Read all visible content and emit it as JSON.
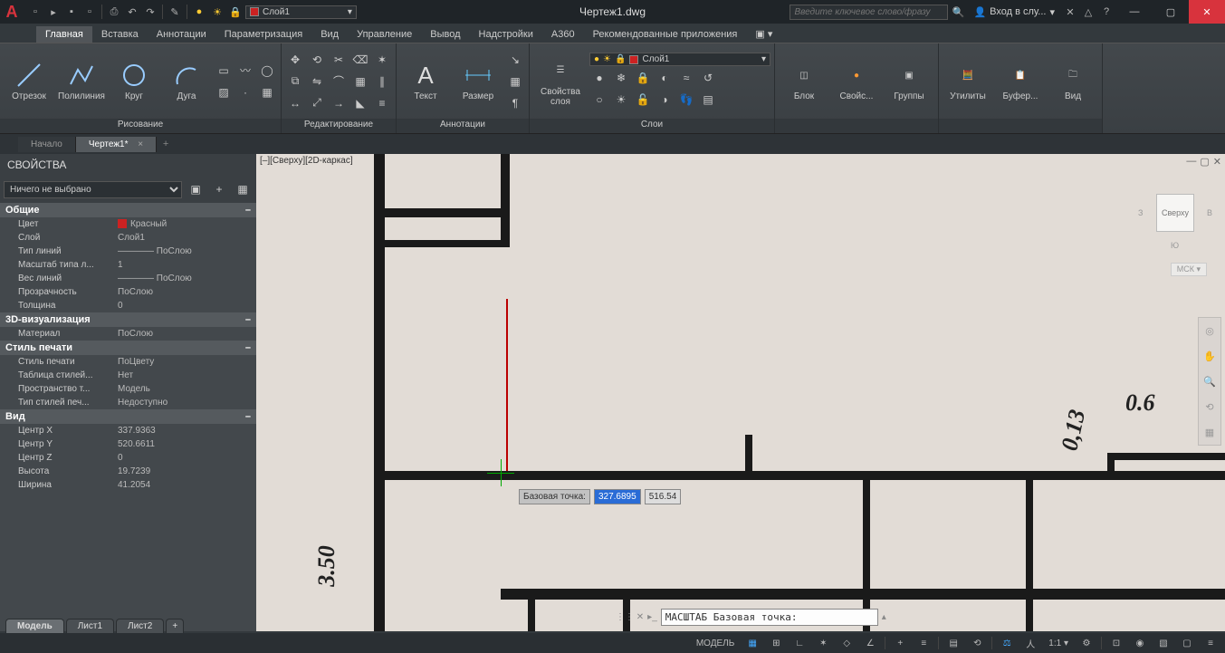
{
  "titlebar": {
    "doc_title": "Чертеж1.dwg",
    "search_placeholder": "Введите ключевое слово/фразу",
    "login_label": "Вход в слу...",
    "layer_quick": "Слой1"
  },
  "ribbon_tabs": [
    "Главная",
    "Вставка",
    "Аннотации",
    "Параметризация",
    "Вид",
    "Управление",
    "Вывод",
    "Надстройки",
    "A360",
    "Рекомендованные приложения"
  ],
  "ribbon": {
    "draw": {
      "title": "Рисование",
      "line": "Отрезок",
      "polyline": "Полилиния",
      "circle": "Круг",
      "arc": "Дуга"
    },
    "modify": {
      "title": "Редактирование"
    },
    "annot": {
      "title": "Аннотации",
      "text": "Текст",
      "dim": "Размер"
    },
    "layers": {
      "title": "Слои",
      "props": "Свойства\nслоя",
      "current": "Слой1"
    },
    "block": {
      "title": "",
      "block": "Блок",
      "props": "Свойс...",
      "groups": "Группы"
    },
    "util": {
      "util": "Утилиты",
      "buf": "Буфер...",
      "view": "Вид"
    }
  },
  "doc_tabs": {
    "start": "Начало",
    "active": "Чертеж1*"
  },
  "props": {
    "title": "СВОЙСТВА",
    "selection": "Ничего не выбрано",
    "groups": {
      "general": {
        "title": "Общие",
        "rows": [
          {
            "k": "Цвет",
            "v": "Красный",
            "swatch": true
          },
          {
            "k": "Слой",
            "v": "Слой1"
          },
          {
            "k": "Тип линий",
            "v": "———— ПоСлою"
          },
          {
            "k": "Масштаб типа л...",
            "v": "1"
          },
          {
            "k": "Вес линий",
            "v": "———— ПоСлою"
          },
          {
            "k": "Прозрачность",
            "v": "ПоСлою"
          },
          {
            "k": "Толщина",
            "v": "0"
          }
        ]
      },
      "viz3d": {
        "title": "3D-визуализация",
        "rows": [
          {
            "k": "Материал",
            "v": "ПоСлою"
          }
        ]
      },
      "plot": {
        "title": "Стиль печати",
        "rows": [
          {
            "k": "Стиль печати",
            "v": "ПоЦвету"
          },
          {
            "k": "Таблица стилей...",
            "v": "Нет"
          },
          {
            "k": "Пространство т...",
            "v": "Модель"
          },
          {
            "k": "Тип стилей печ...",
            "v": "Недоступно"
          }
        ]
      },
      "view": {
        "title": "Вид",
        "rows": [
          {
            "k": "Центр X",
            "v": "337.9363"
          },
          {
            "k": "Центр Y",
            "v": "520.6611"
          },
          {
            "k": "Центр Z",
            "v": "0"
          },
          {
            "k": "Высота",
            "v": "19.7239"
          },
          {
            "k": "Ширина",
            "v": "41.2054"
          }
        ]
      }
    }
  },
  "viewport": {
    "label": "[–][Сверху][2D-каркас]",
    "cube_face": "Сверху",
    "cube_w": "З",
    "cube_e": "В",
    "cube_s": "Ю",
    "wcs": "МСК",
    "coord_label": "Базовая точка:",
    "coord_x": "327.6895",
    "coord_y": "516.54",
    "dim1": "3.50",
    "dim2": "0,13",
    "dim3": "0.6"
  },
  "cmd": {
    "prompt": "МАСШТАБ Базовая точка:"
  },
  "layout_tabs": {
    "model": "Модель",
    "l1": "Лист1",
    "l2": "Лист2"
  },
  "status": {
    "model": "МОДЕЛЬ",
    "scale": "1:1"
  }
}
